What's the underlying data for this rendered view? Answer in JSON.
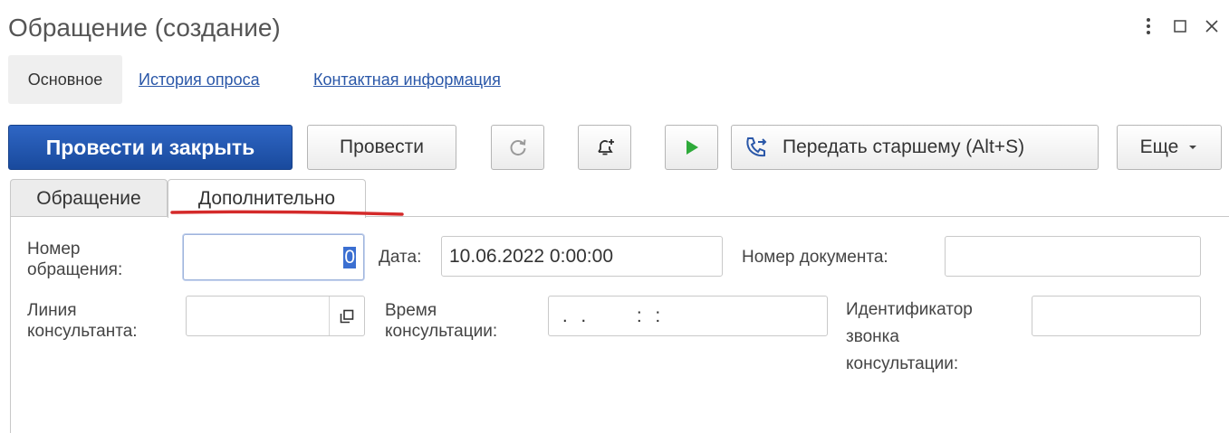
{
  "window": {
    "title": "Обращение (создание)",
    "more_icon": "vertical-dots-icon",
    "maximize_icon": "maximize-square-icon",
    "close_icon": "close-x-icon"
  },
  "nav": {
    "active": "Основное",
    "links": [
      "История опроса",
      "Контактная информация"
    ]
  },
  "toolbar": {
    "primary": "Провести и закрыть",
    "post": "Провести",
    "refresh_icon": "refresh-icon",
    "reminder_icon": "bell-plus-icon",
    "run_icon": "play-icon",
    "escalate_icon": "phone-transfer-icon",
    "escalate": "Передать старшему (Alt+S)",
    "more": "Еще",
    "more_icon": "chevron-down-icon",
    "accent": "#1f55b3",
    "run_color": "#2eaa3a"
  },
  "tabs": {
    "items": [
      "Обращение",
      "Дополнительно"
    ],
    "active": "Дополнительно",
    "underline_color": "#d42a2a"
  },
  "form": {
    "request_number": {
      "label": "Номер\nобращения:",
      "value": "0"
    },
    "date": {
      "label": "Дата:",
      "value": "10.06.2022  0:00:00"
    },
    "document_number": {
      "label": "Номер документа:",
      "value": ""
    },
    "consultant_line": {
      "label": "Линия\nконсультанта:",
      "value": "",
      "open_icon": "open-window-icon"
    },
    "consultation_time": {
      "label": "Время\nконсультации:",
      "value": " .  .        :  :"
    },
    "call_id": {
      "label": "Идентификатор\nзвонка\nконсультации:",
      "value": ""
    }
  }
}
